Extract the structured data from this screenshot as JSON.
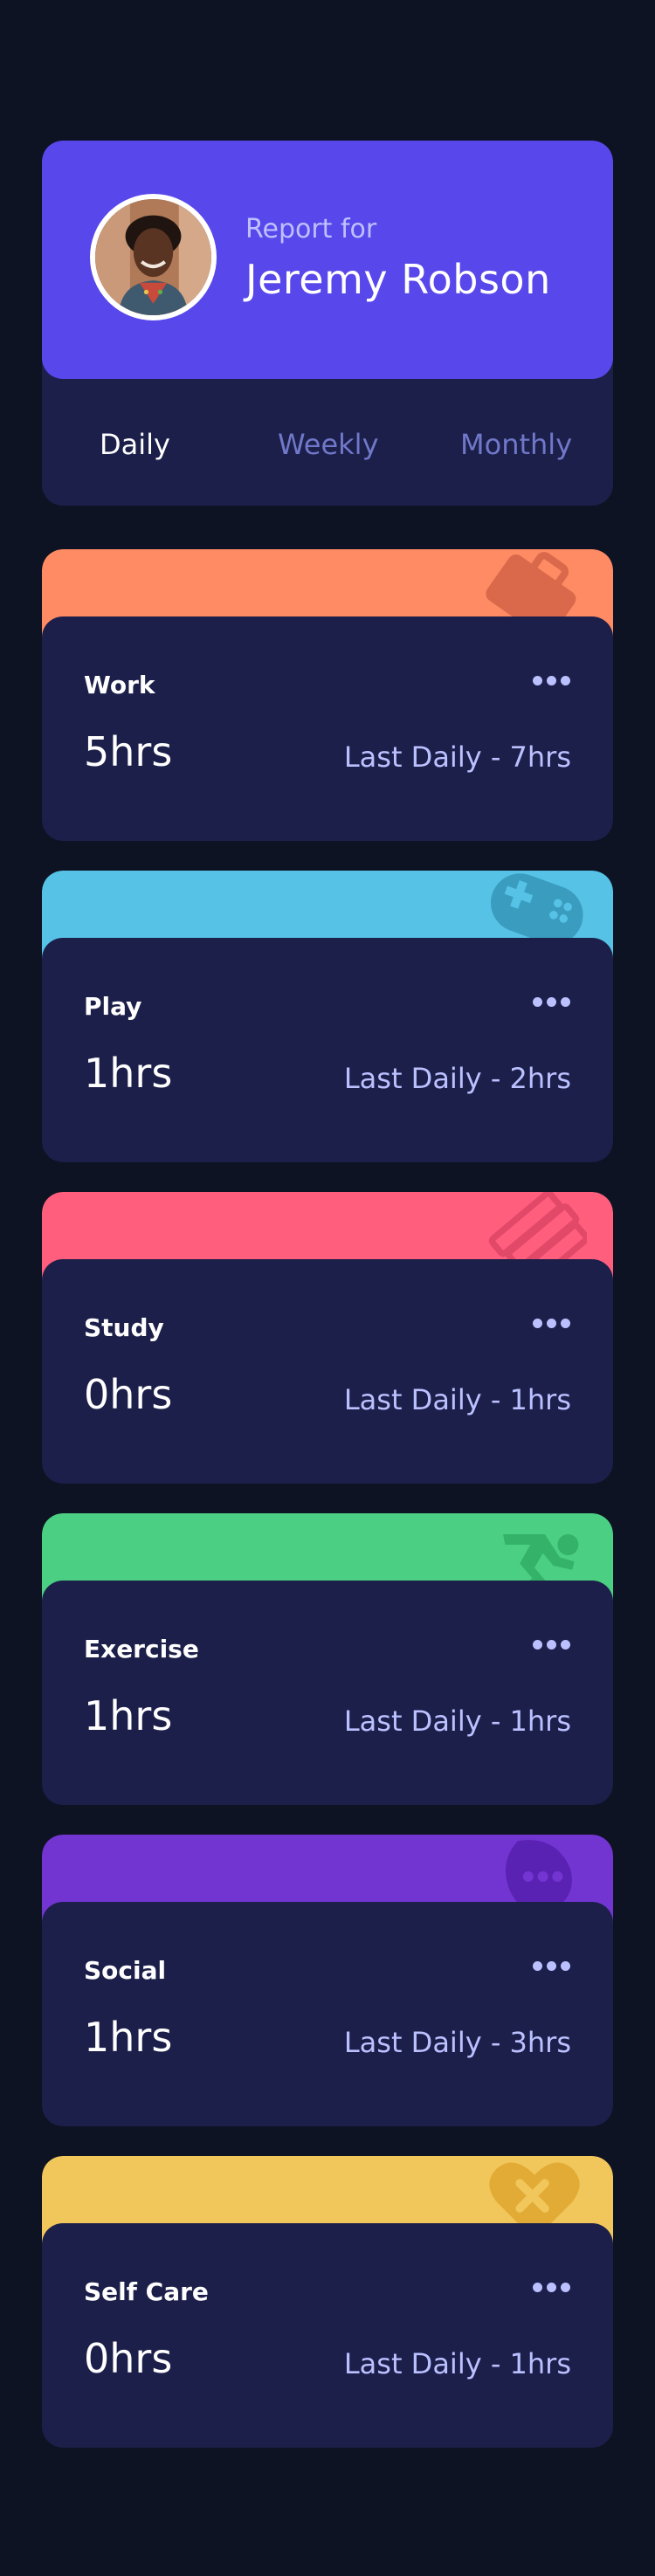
{
  "profile": {
    "report_for": "Report for",
    "name": "Jeremy Robson",
    "tabs": [
      {
        "label": "Daily",
        "active": true
      },
      {
        "label": "Weekly",
        "active": false
      },
      {
        "label": "Monthly",
        "active": false
      }
    ]
  },
  "colors": {
    "background": "#0e1323",
    "card": "#1c1f4a",
    "profile": "#5847eb",
    "muted_text": "#bbc0ff",
    "tab_inactive": "#7078c9"
  },
  "activities": [
    {
      "title": "Work",
      "hours": "5hrs",
      "previous": "Last Daily - 7hrs",
      "color": "#ff8b64",
      "icon": "briefcase-icon"
    },
    {
      "title": "Play",
      "hours": "1hrs",
      "previous": "Last Daily - 2hrs",
      "color": "#55c2e6",
      "icon": "gamepad-icon"
    },
    {
      "title": "Study",
      "hours": "0hrs",
      "previous": "Last Daily - 1hrs",
      "color": "#ff5e7d",
      "icon": "books-icon"
    },
    {
      "title": "Exercise",
      "hours": "1hrs",
      "previous": "Last Daily - 1hrs",
      "color": "#4bcf82",
      "icon": "running-icon"
    },
    {
      "title": "Social",
      "hours": "1hrs",
      "previous": "Last Daily - 3hrs",
      "color": "#7335d2",
      "icon": "chat-icon"
    },
    {
      "title": "Self Care",
      "hours": "0hrs",
      "previous": "Last Daily - 1hrs",
      "color": "#f1c75b",
      "icon": "heart-icon"
    }
  ]
}
